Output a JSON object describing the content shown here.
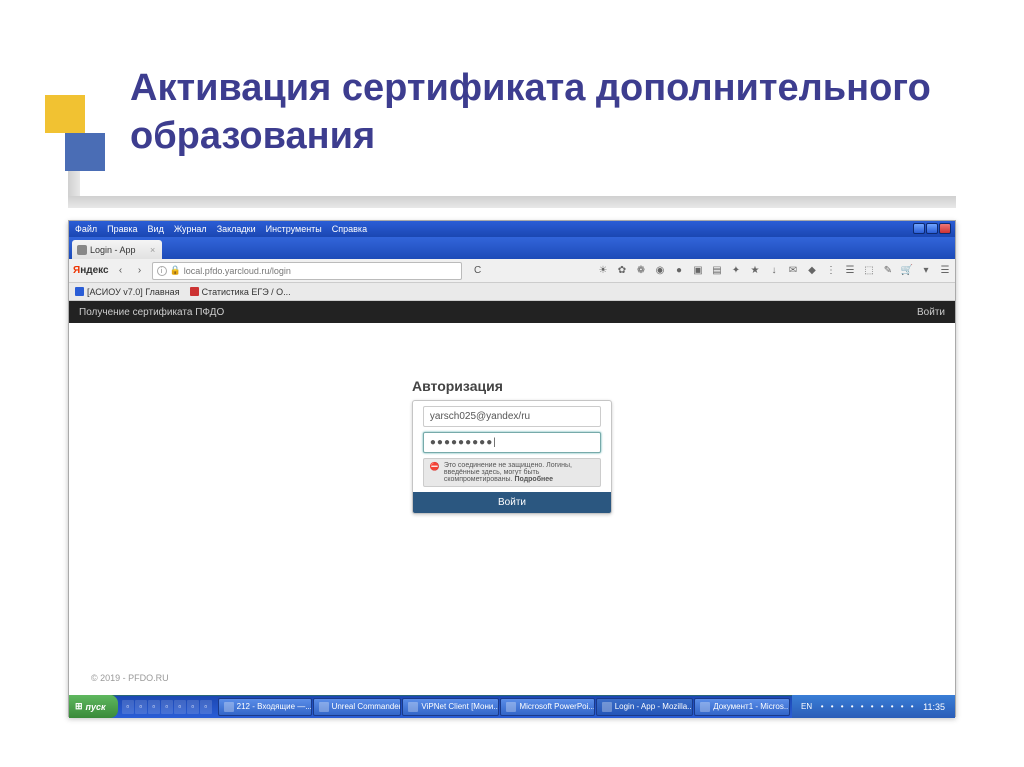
{
  "slide": {
    "title": "Активация сертификата дополнительного образования"
  },
  "browser": {
    "menubar": [
      "Файл",
      "Правка",
      "Вид",
      "Журнал",
      "Закладки",
      "Инструменты",
      "Справка"
    ],
    "tab": {
      "title": "Login - App"
    },
    "search_engine": "Яндекс",
    "url_prefix": "local.pfdo.yarcloud.ru/login",
    "refresh_symbol": "С",
    "bookmarks": [
      {
        "label": "[АСИОУ v7.0] Главная",
        "color": "#2a5dd6"
      },
      {
        "label": "Статистика ЕГЭ / О...",
        "color": "#c33"
      }
    ]
  },
  "toolbar_icons": [
    "☀",
    "✿",
    "❁",
    "◉",
    "●",
    "▣",
    "▤",
    "✦",
    "★",
    "↓",
    "✉",
    "◆",
    "⋮",
    "☰",
    "⬚",
    "✎",
    "🛒",
    "▾",
    "☰"
  ],
  "page": {
    "header_title": "Получение сертификата ПФДО",
    "header_login": "Войти",
    "auth": {
      "title": "Авторизация",
      "email": "yarsch025@yandex/ru",
      "password_mask": "●●●●●●●●●|",
      "warning": "Это соединение не защищено. Логины, введённые здесь, могут быть скомпрометированы.",
      "warning_bold": "Подробнее",
      "submit": "Войти"
    },
    "footer": "© 2019 - PFDO.RU"
  },
  "taskbar": {
    "start": "пуск",
    "quicklaunch_count": 7,
    "tasks": [
      "212 - Входящие —...",
      "Unreal Commander",
      "ViPNet Client [Мони...",
      "Microsoft PowerPoi...",
      "Login - App - Mozilla...",
      "Документ1 - Micros..."
    ],
    "lang": "EN",
    "tray_count": 10,
    "clock": "11:35"
  }
}
